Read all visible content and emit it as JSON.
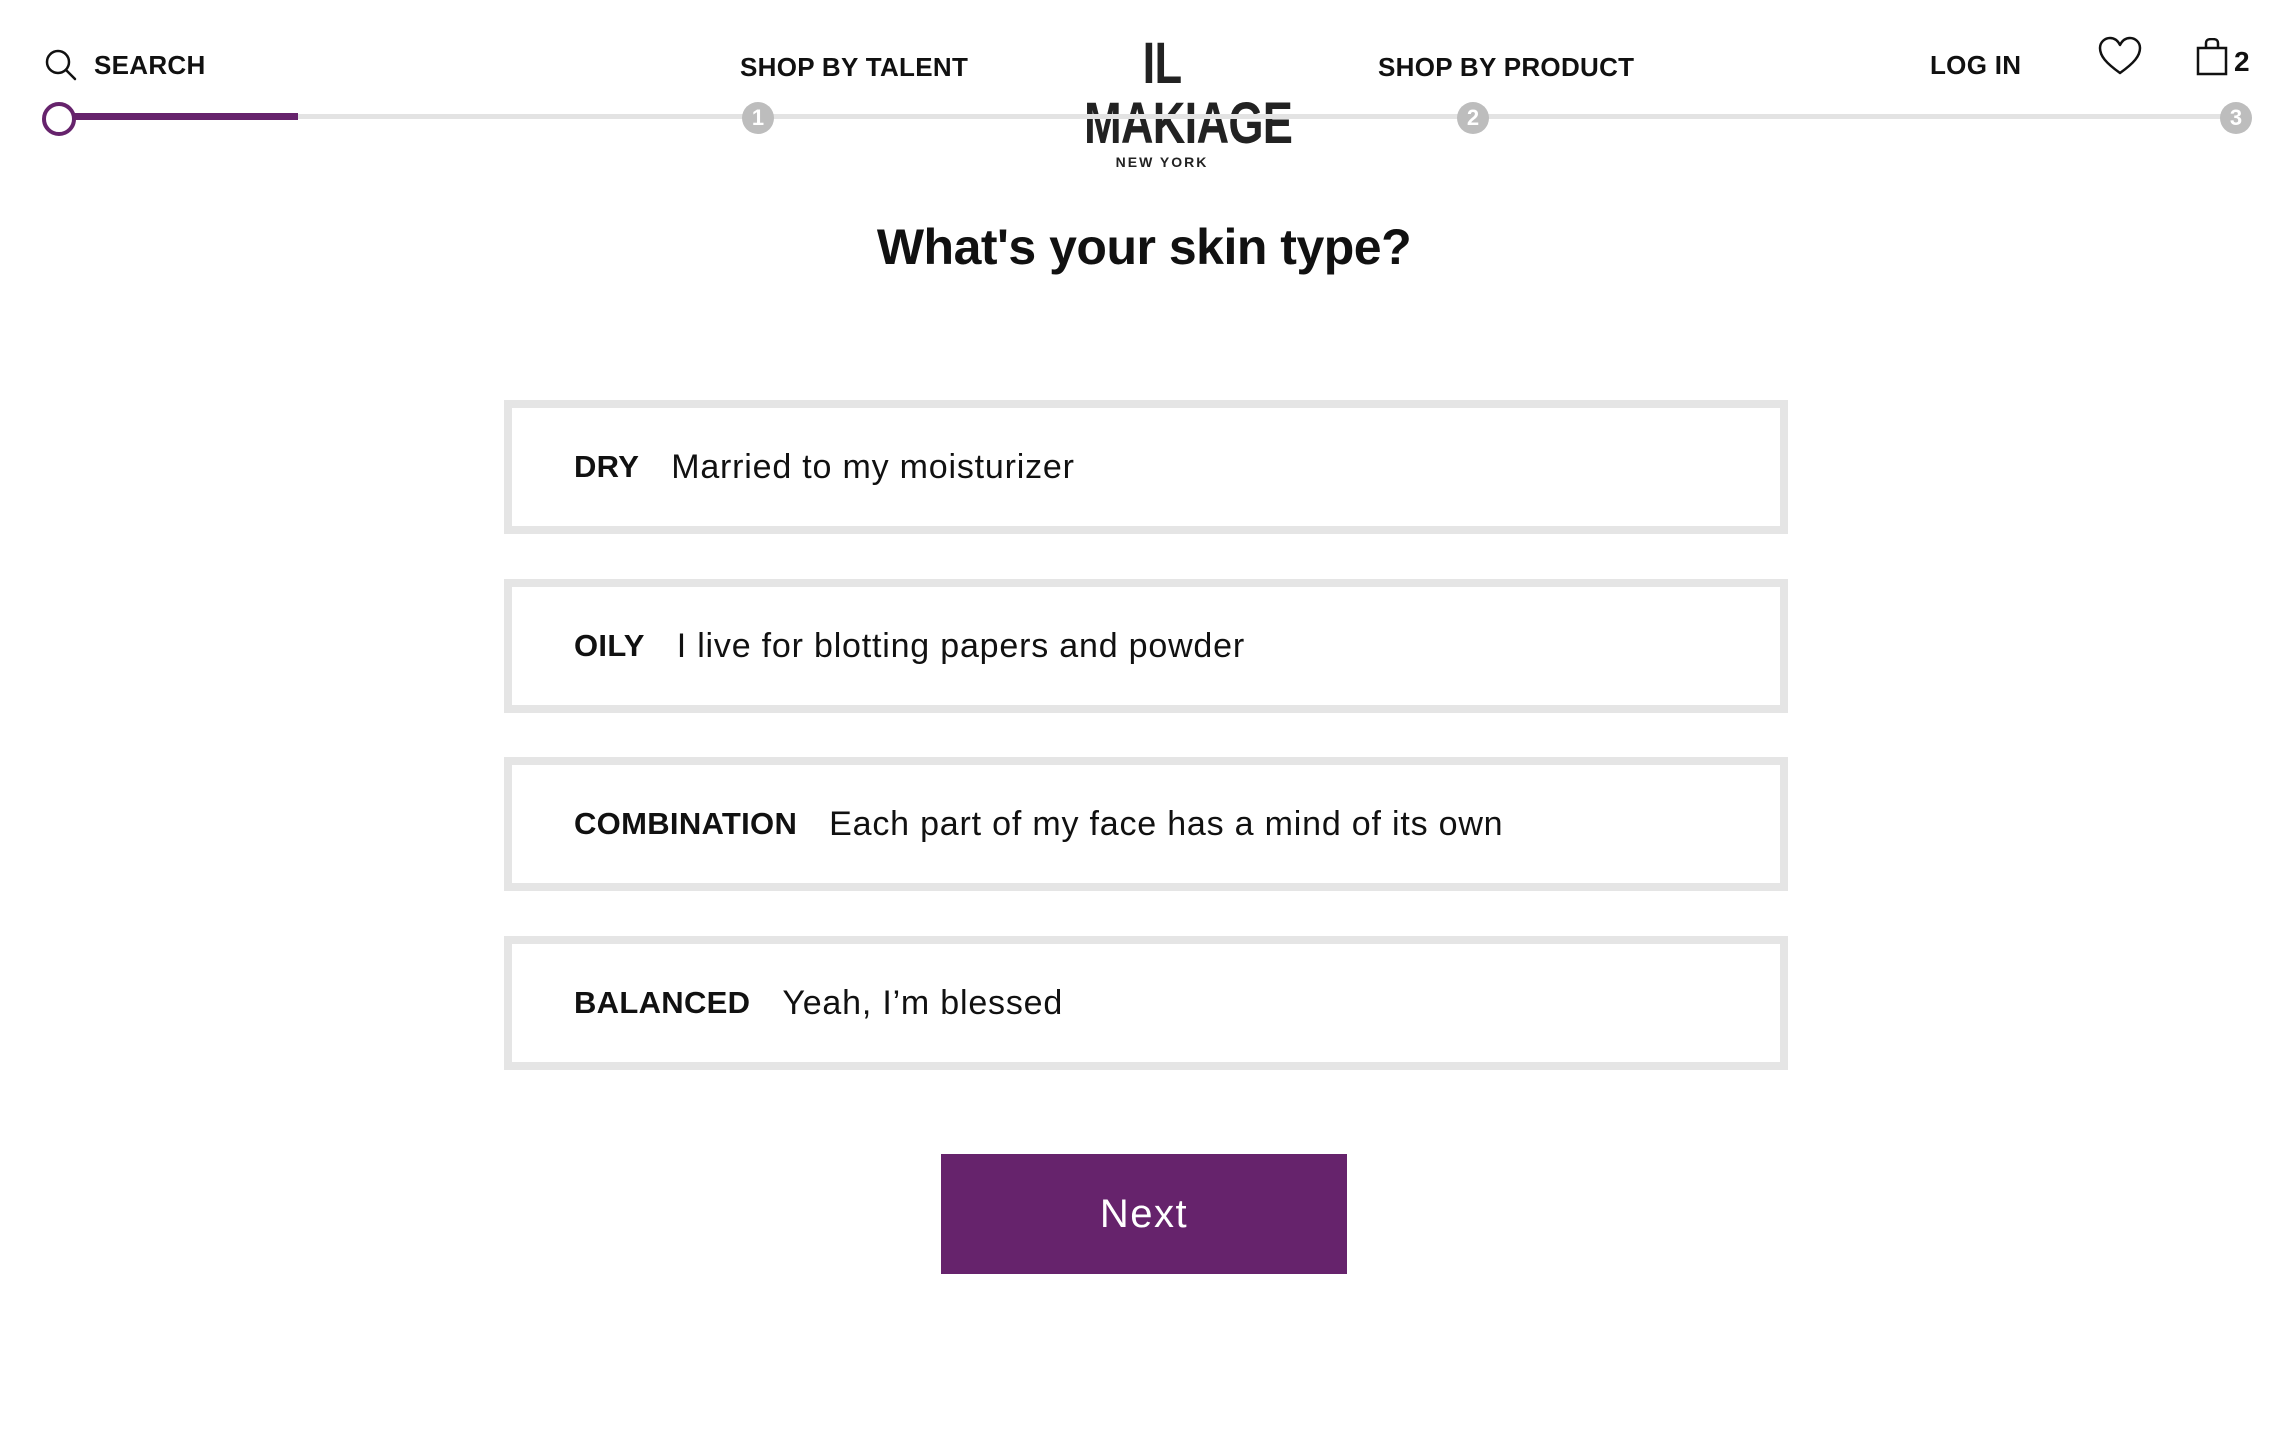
{
  "header": {
    "search_label": "SEARCH",
    "shop_by_talent": "SHOP BY TALENT",
    "logo_main": "IL MAKIAGE",
    "logo_sub": "NEW YORK",
    "shop_by_product": "SHOP BY PRODUCT",
    "login": "LOG IN",
    "cart_count": "2",
    "icons": [
      "search-icon",
      "heart-icon",
      "shopping-bag-icon"
    ]
  },
  "progress": {
    "fraction": 0.08,
    "steps": [
      "1",
      "2",
      "3"
    ],
    "accent_color": "#66236c",
    "inactive_color": "#bdbdbd"
  },
  "quiz": {
    "question": "What's your skin type?",
    "options": [
      {
        "label": "DRY",
        "description": "Married to my moisturizer"
      },
      {
        "label": "OILY",
        "description": "I live for blotting papers and powder"
      },
      {
        "label": "COMBINATION",
        "description": "Each part of my face has a mind of its own"
      },
      {
        "label": "BALANCED",
        "description": "Yeah, I’m blessed"
      }
    ],
    "next_label": "Next"
  }
}
